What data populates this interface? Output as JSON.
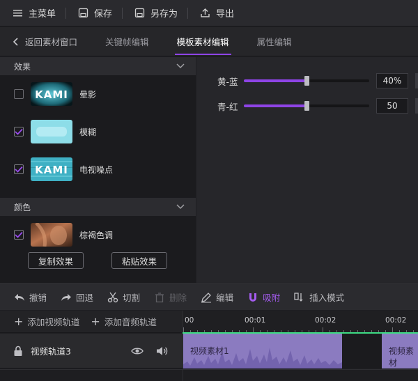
{
  "menu": {
    "main_menu": "主菜单",
    "save": "保存",
    "save_as": "另存为",
    "export": "导出"
  },
  "tabs": {
    "back": "返回素材窗口",
    "keyframe": "关键帧编辑",
    "template": "模板素材编辑",
    "properties": "属性编辑"
  },
  "effects_panel": {
    "title": "效果",
    "items": [
      {
        "label": "晕影",
        "checked": false
      },
      {
        "label": "模糊",
        "checked": true
      },
      {
        "label": "电视噪点",
        "checked": true
      }
    ]
  },
  "color_panel": {
    "title": "颜色",
    "items": [
      {
        "label": "棕褐色调",
        "checked": true
      }
    ]
  },
  "buttons": {
    "copy_effect": "复制效果",
    "paste_effect": "粘贴效果"
  },
  "sliders": [
    {
      "label": "黄-蓝",
      "value_text": "40%",
      "level": 0.5
    },
    {
      "label": "青-红",
      "value_text": "50",
      "level": 0.5
    }
  ],
  "toolbar": {
    "undo": "撤销",
    "redo": "回退",
    "cut": "切割",
    "delete": "删除",
    "edit": "编辑",
    "snap": "吸附",
    "insert_mode": "插入模式"
  },
  "timeline": {
    "add_video_track": "添加视频轨道",
    "add_audio_track": "添加音频轨道",
    "ticks": [
      "00",
      "00:01",
      "00:02",
      "00:02"
    ],
    "track_name": "视频轨道3",
    "clips": [
      "视频素材1",
      "视频素材"
    ]
  },
  "colors": {
    "accent": "#8e44e6",
    "clip": "#8b7bc0",
    "playhead_line": "#3ddc84"
  }
}
